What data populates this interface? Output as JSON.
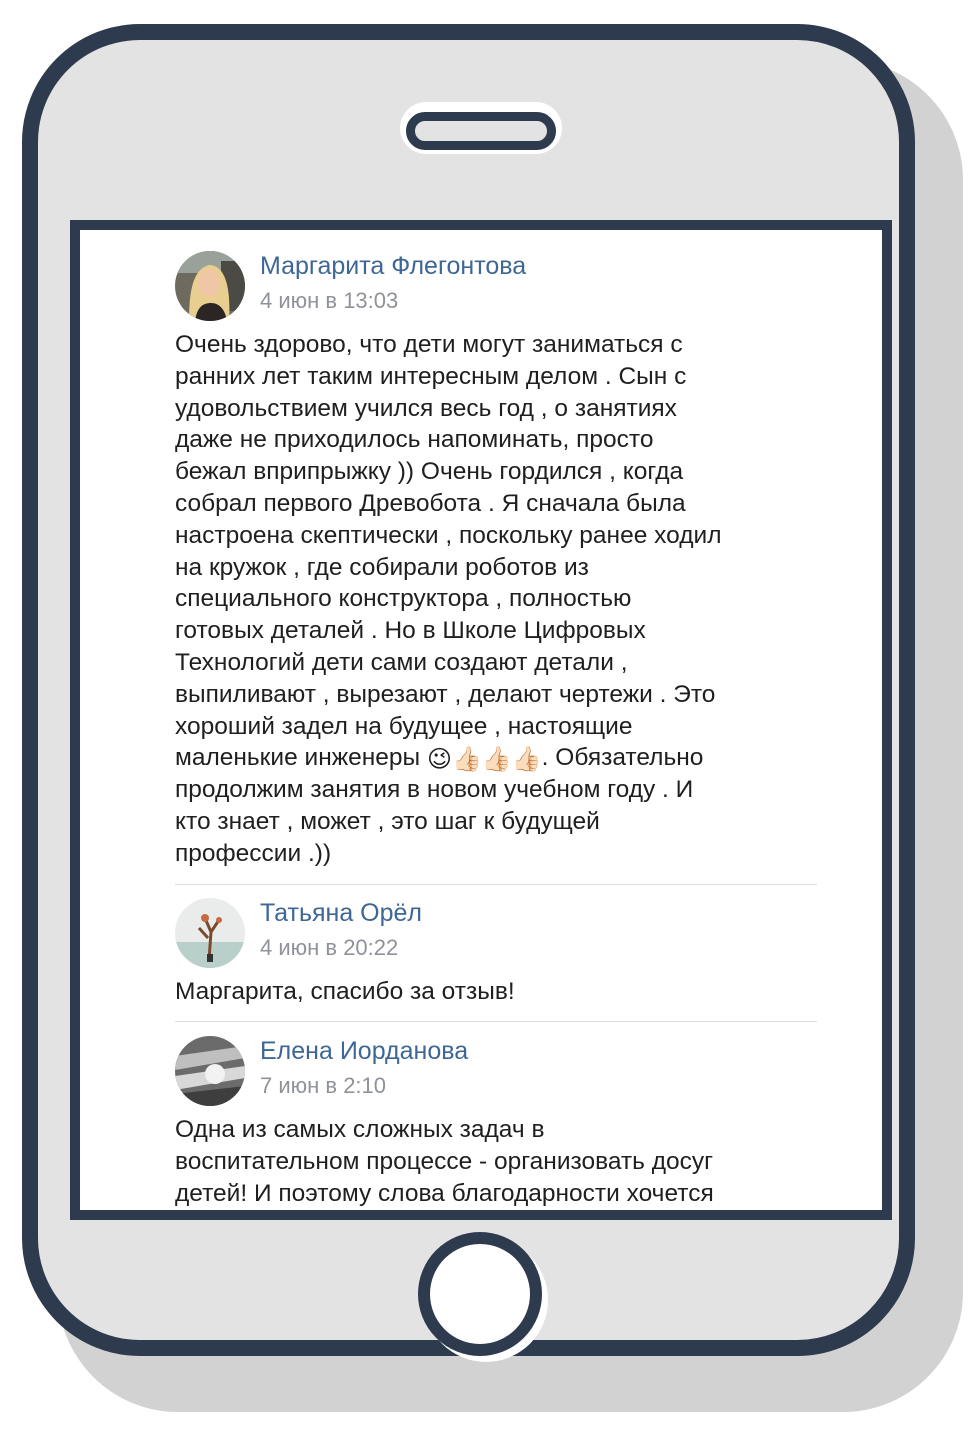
{
  "comments": [
    {
      "author": "Маргарита Флегонтова",
      "date": "4 июн в 13:03",
      "text_before_emoji": "Очень здорово, что дети могут заниматься с\nранних лет таким интересным делом . Сын с\nудовольствием учился весь год , о занятиях\nдаже не приходилось напоминать, просто\nбежал вприпрыжку )) Очень гордился , когда\nсобрал первого Древобота . Я сначала была\nнастроена скептически , поскольку ранее ходил\nна кружок , где собирали роботов из\nспециального конструктора , полностью\nготовых деталей . Но в Школе Цифровых\nТехнологий дети сами создают детали ,\nвыпиливают , вырезают , делают чертежи . Это\nхороший задел на будущее , настоящие\nмаленькие инженеры ",
      "emojis": [
        "😉",
        "👍🏻",
        "👍🏻",
        "👍🏻"
      ],
      "text_after_emoji": ". Обязательно\nпродолжим занятия в новом учебном году . И\nкто знает , может , это шаг к будущей\nпрофессии .))"
    },
    {
      "author": "Татьяна Орёл",
      "date": "4 июн в 20:22",
      "text": "Маргарита, спасибо за отзыв!"
    },
    {
      "author": "Елена Иорданова",
      "date": "7 июн в 2:10",
      "text": "Одна из самых сложных задач в\nвоспитательном процессе - организовать досуг\nдетей! И поэтому слова благодарности хочется"
    }
  ],
  "colors": {
    "frame": "#2e3a4d",
    "author_link": "#3e6796",
    "date": "#8f9399"
  },
  "icons": [
    "avatar-margarita",
    "avatar-tatiana",
    "avatar-elena",
    "wink-emoji",
    "thumbs-up-emoji"
  ]
}
